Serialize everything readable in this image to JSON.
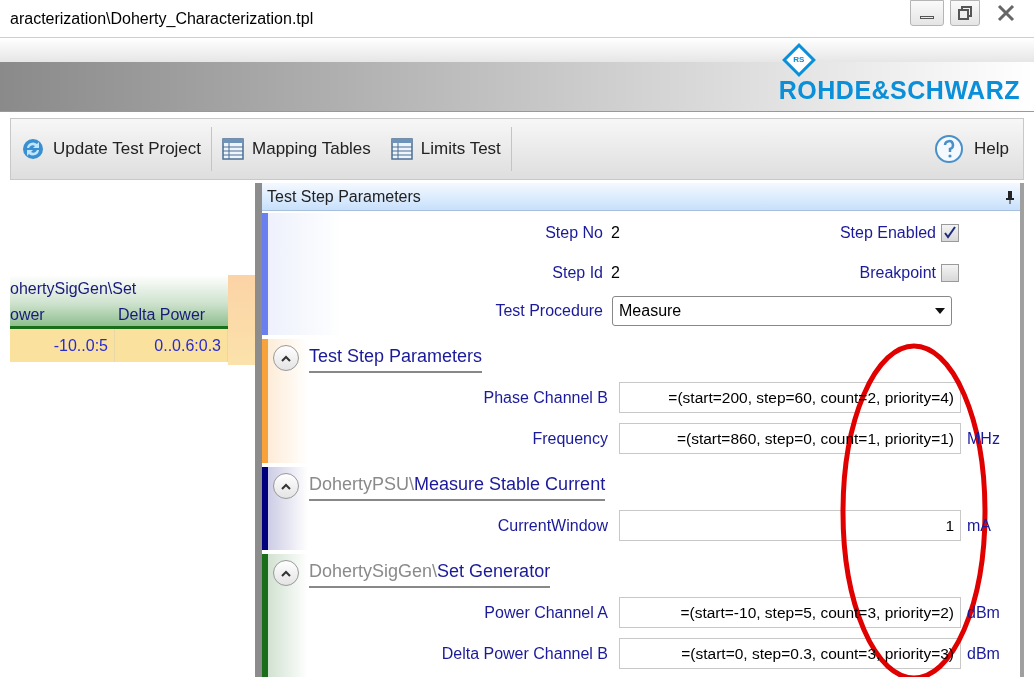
{
  "window": {
    "title": "aracterization\\Doherty_Characterization.tpl"
  },
  "logo": {
    "mark": "RS",
    "name": "ROHDE&SCHWARZ"
  },
  "toolbar": {
    "items": [
      {
        "label": "Update Test Project",
        "kind": "refresh"
      },
      {
        "label": "Mapping Tables",
        "kind": "table"
      },
      {
        "label": "Limits Test",
        "kind": "table"
      }
    ],
    "help": "Help"
  },
  "left_table": {
    "group": "ohertySigGen\\Set",
    "columns": [
      "ower",
      "Delta Power"
    ],
    "rows": [
      [
        "-10..0:5",
        "0..0.6:0.3"
      ]
    ]
  },
  "panel": {
    "title": "Test Step Parameters",
    "step_no": {
      "label": "Step No",
      "value": "2"
    },
    "step_id": {
      "label": "Step Id",
      "value": "2"
    },
    "step_enabled": {
      "label": "Step Enabled",
      "checked": true
    },
    "breakpoint": {
      "label": "Breakpoint",
      "checked": false
    },
    "test_procedure": {
      "label": "Test Procedure",
      "value": "Measure"
    },
    "groups": [
      {
        "title": "Test Step Parameters",
        "expanded": true,
        "color": "#f7a23a",
        "params": [
          {
            "label": "Phase Channel B",
            "value": "=(start=200, step=60, count=2, priority=4)"
          },
          {
            "label": "Frequency",
            "value": "=(start=860, step=0, count=1, priority=1)",
            "unit": "MHz"
          }
        ]
      },
      {
        "prefix": "DohertyPSU\\",
        "title": "Measure Stable Current",
        "expanded": true,
        "color": "#00007f",
        "params": [
          {
            "label": "CurrentWindow",
            "value": "1",
            "unit": "mA"
          }
        ]
      },
      {
        "prefix": "DohertySigGen\\",
        "title": "Set Generator",
        "expanded": true,
        "color": "#1a6e1a",
        "params": [
          {
            "label": "Power Channel A",
            "value": "=(start=-10, step=5, count=3, priority=2)",
            "unit": "dBm"
          },
          {
            "label": "Delta Power Channel B",
            "value": "=(start=0, step=0.3, count=3, priority=3)",
            "unit": "dBm"
          }
        ]
      }
    ]
  }
}
